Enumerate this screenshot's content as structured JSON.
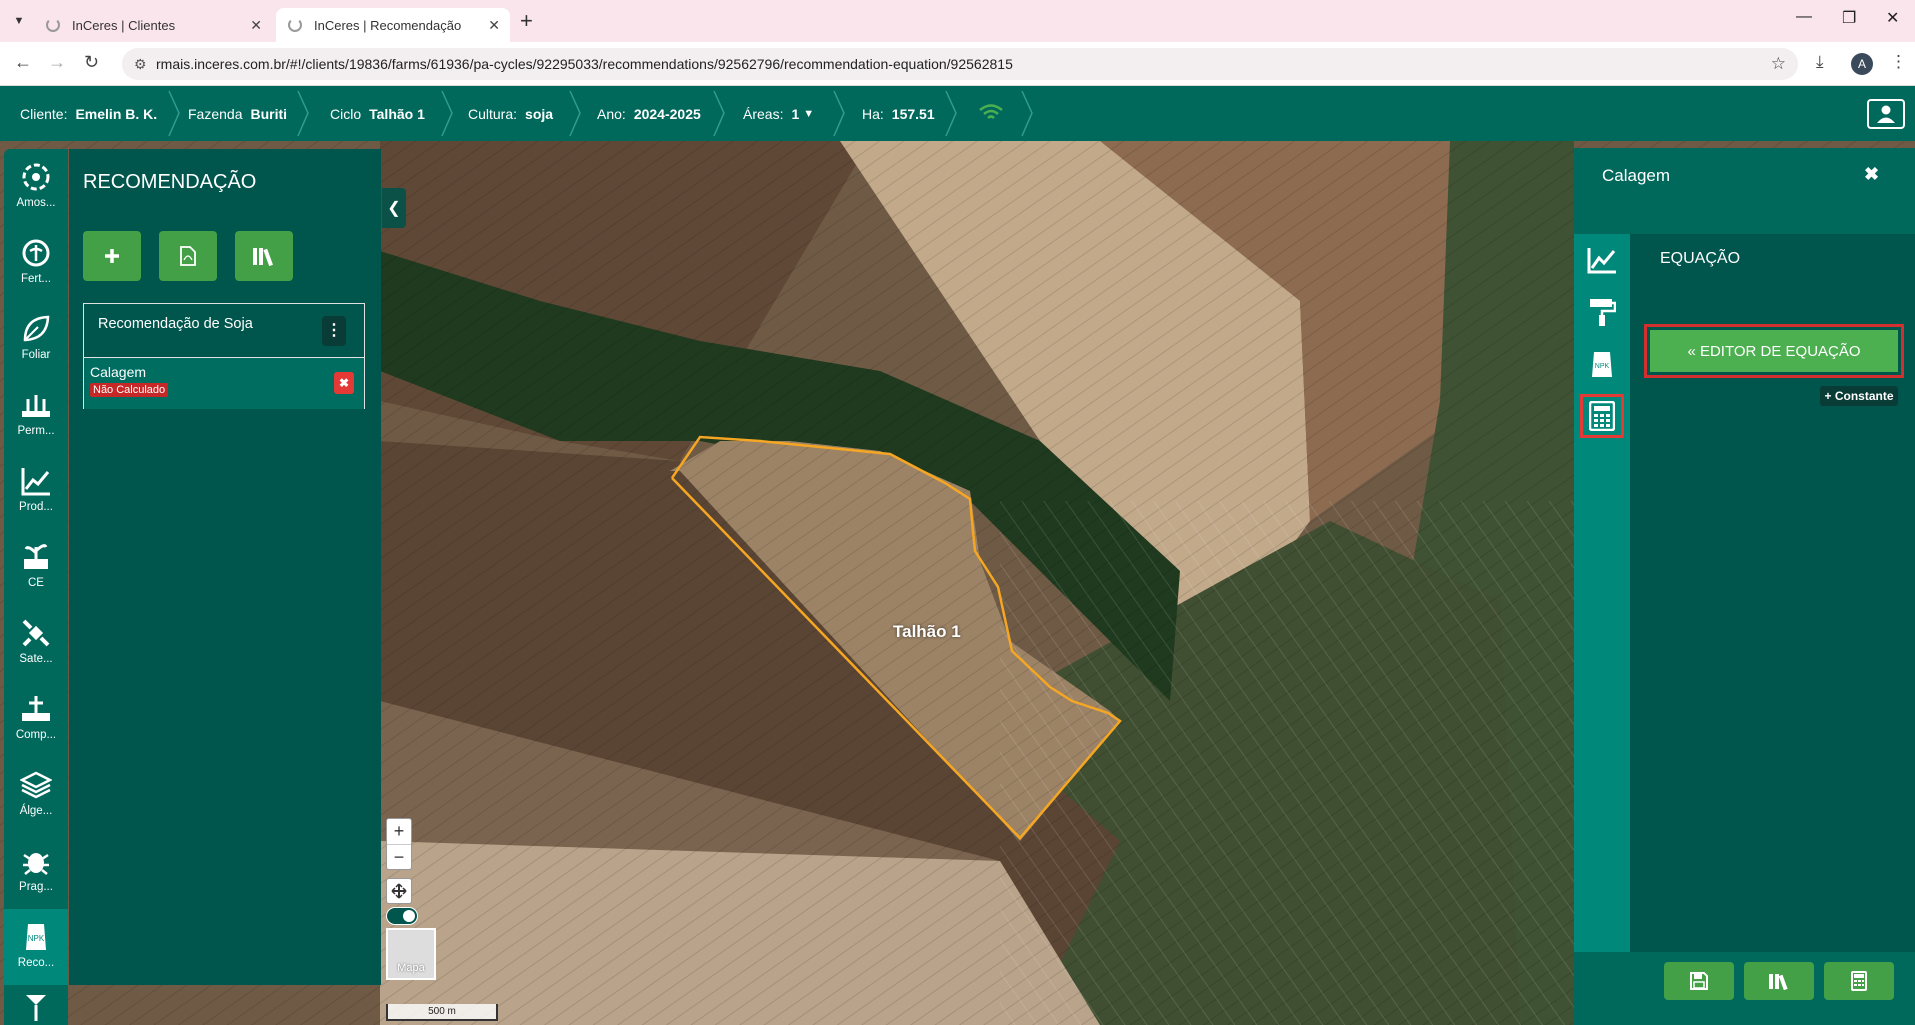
{
  "browser": {
    "tabs": [
      {
        "title": "InCeres | Clientes",
        "active": false
      },
      {
        "title": "InCeres | Recomendação",
        "active": true
      }
    ],
    "url": "rmais.inceres.com.br/#!/clients/19836/farms/61936/pa-cycles/92295033/recommendations/92562796/recommendation-equation/92562815",
    "profile_initial": "A"
  },
  "topnav": {
    "client_label": "Cliente:",
    "client_value": "Emelin B. K.",
    "farm_label": "Fazenda",
    "farm_value": "Buriti",
    "cycle_label": "Ciclo",
    "cycle_value": "Talhão 1",
    "crop_label": "Cultura:",
    "crop_value": "soja",
    "year_label": "Ano:",
    "year_value": "2024-2025",
    "areas_label": "Áreas:",
    "areas_value": "1",
    "ha_label": "Ha:",
    "ha_value": "157.51"
  },
  "sidebar": {
    "items": [
      {
        "label": "Amos...",
        "icon": "sampling-icon"
      },
      {
        "label": "Fert...",
        "icon": "fertility-icon"
      },
      {
        "label": "Foliar",
        "icon": "leaf-icon"
      },
      {
        "label": "Perm...",
        "icon": "permanent-crop-icon"
      },
      {
        "label": "Prod...",
        "icon": "productivity-chart-icon"
      },
      {
        "label": "CE",
        "icon": "ce-plant-icon"
      },
      {
        "label": "Sate...",
        "icon": "satellite-icon"
      },
      {
        "label": "Comp...",
        "icon": "compaction-icon"
      },
      {
        "label": "Álge...",
        "icon": "layers-icon"
      },
      {
        "label": "Prag...",
        "icon": "bug-icon"
      },
      {
        "label": "Reco...",
        "icon": "npk-bag-icon"
      }
    ]
  },
  "recommendation": {
    "title": "RECOMENDAÇÃO",
    "group_name": "Recomendação de Soja",
    "item_name": "Calagem",
    "item_status": "Não Calculado"
  },
  "map": {
    "field_label": "Talhão 1",
    "minimap_label": "Mapa",
    "scale_label": "500 m"
  },
  "right_panel": {
    "title": "Calagem",
    "section_title": "EQUAÇÃO",
    "editor_button": "« EDITOR DE EQUAÇÃO",
    "constant_button": "+ Constante"
  },
  "colors": {
    "primary": "#00695c",
    "panel": "#00564d",
    "accent_green": "#43a047",
    "danger": "#e53935",
    "field_outline": "#f5a623"
  }
}
